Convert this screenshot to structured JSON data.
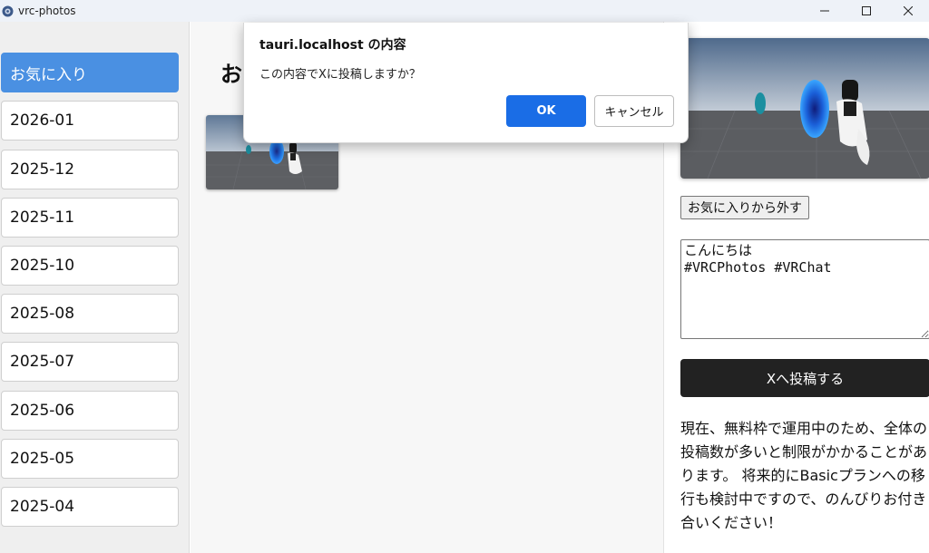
{
  "window": {
    "title": "vrc-photos",
    "icon": "vrc-app-icon",
    "controls": [
      "minimize-icon",
      "maximize-icon",
      "close-icon"
    ]
  },
  "sidebar": {
    "items": [
      {
        "label": "お気に入り",
        "active": true
      },
      {
        "label": "2026-01"
      },
      {
        "label": "2025-12"
      },
      {
        "label": "2025-11"
      },
      {
        "label": "2025-10"
      },
      {
        "label": "2025-08"
      },
      {
        "label": "2025-07"
      },
      {
        "label": "2025-06"
      },
      {
        "label": "2025-05"
      },
      {
        "label": "2025-04"
      }
    ]
  },
  "main": {
    "heading": "お"
  },
  "panel": {
    "unfavorite_label": "お気に入りから外す",
    "post_text": "こんにちは\n#VRCPhotos #VRChat",
    "post_button_label": "Xへ投稿する",
    "note": "現在、無料枠で運用中のため、全体の投稿数が多いと制限がかかることがあります。 将来的にBasicプランへの移行も検討中ですので、のんびりお付き合いください！"
  },
  "dialog": {
    "title": "tauri.localhost の内容",
    "message": "この内容でXに投稿しますか？",
    "ok_label": "OK",
    "cancel_label": "キャンセル"
  },
  "colors": {
    "accent": "#4a90e2",
    "ok_button": "#1a6de6",
    "post_button": "#222222"
  }
}
